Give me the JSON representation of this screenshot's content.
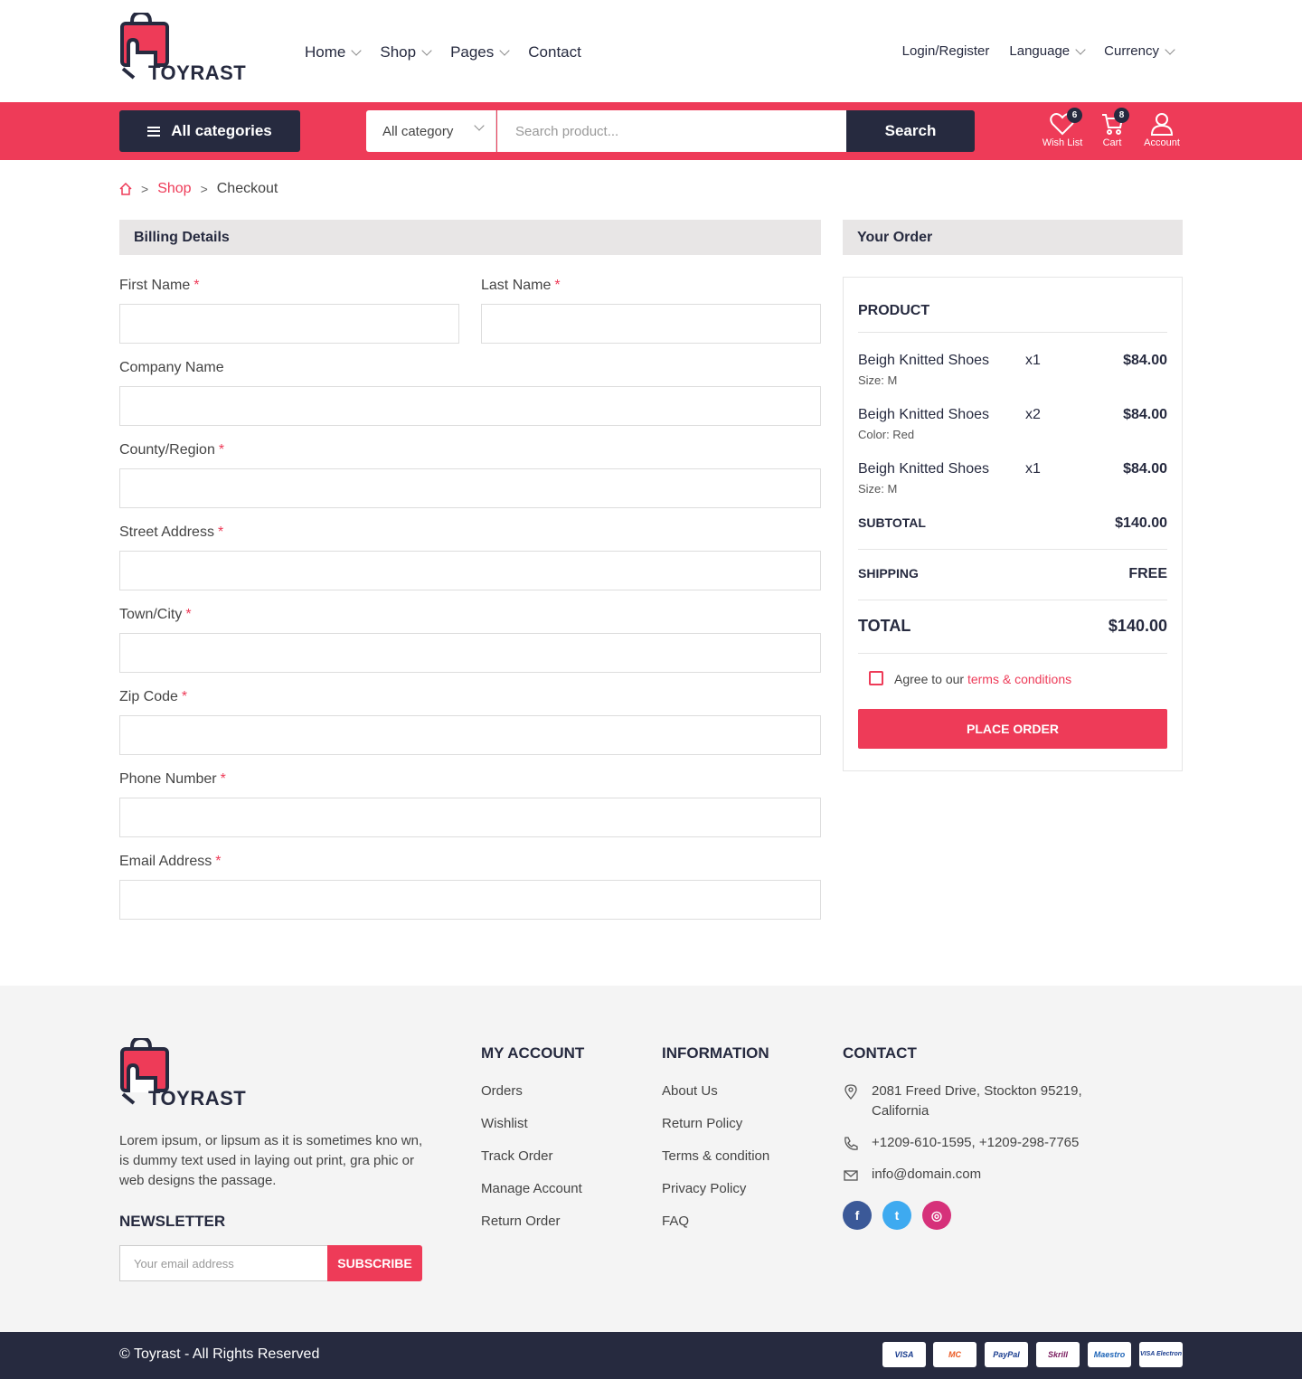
{
  "brand": {
    "name": "TOYRAST",
    "accent": "#ee3b58",
    "dark": "#262a3f"
  },
  "nav": {
    "items": [
      "Home",
      "Shop",
      "Pages",
      "Contact"
    ]
  },
  "topright": {
    "login": "Login/Register",
    "language": "Language",
    "currency": "Currency"
  },
  "toolbar": {
    "all_categories": "All categories",
    "category_select": "All category",
    "search_placeholder": "Search product...",
    "search_button": "Search",
    "wishlist_label": "Wish List",
    "wishlist_count": "6",
    "cart_label": "Cart",
    "cart_count": "8",
    "account_label": "Account"
  },
  "breadcrumb": {
    "shop": "Shop",
    "current": "Checkout"
  },
  "billing": {
    "title": "Billing Details",
    "fields": {
      "first_name": "First Name",
      "last_name": "Last Name",
      "company": "Company Name",
      "county": "County/Region",
      "street": "Street Address",
      "town": "Town/City",
      "zip": "Zip Code",
      "phone": "Phone Number",
      "email": "Email Address"
    },
    "required_mark": "*"
  },
  "order": {
    "title": "Your Order",
    "product_header": "PRODUCT",
    "items": [
      {
        "name": "Beigh Knitted Shoes",
        "qty": "x1",
        "price": "$84.00",
        "detail": "Size: M"
      },
      {
        "name": "Beigh Knitted Shoes",
        "qty": "x2",
        "price": "$84.00",
        "detail": "Color: Red"
      },
      {
        "name": "Beigh Knitted Shoes",
        "qty": "x1",
        "price": "$84.00",
        "detail": "Size: M"
      }
    ],
    "subtotal_label": "SUBTOTAL",
    "subtotal": "$140.00",
    "shipping_label": "SHIPPING",
    "shipping": "FREE",
    "total_label": "TOTAL",
    "total": "$140.00",
    "agree_text": "Agree to our",
    "agree_link": "terms & conditions",
    "place_order": "PLACE ORDER"
  },
  "footer": {
    "about": "Lorem ipsum, or lipsum as it is sometimes kno wn, is dummy text used in laying out print, gra phic or web designs the passage.",
    "newsletter_title": "NEWSLETTER",
    "newsletter_placeholder": "Your email address",
    "subscribe": "SUBSCRIBE",
    "account_title": "MY ACCOUNT",
    "account_links": [
      "Orders",
      "Wishlist",
      "Track Order",
      "Manage Account",
      "Return Order"
    ],
    "info_title": "INFORMATION",
    "info_links": [
      "About Us",
      "Return Policy",
      "Terms & condition",
      "Privacy Policy",
      "FAQ"
    ],
    "contact_title": "CONTACT",
    "address": "2081 Freed Drive, Stockton 95219, California",
    "phone": "+1209-610-1595, +1209-298-7765",
    "email": "info@domain.com",
    "social": [
      {
        "name": "facebook",
        "color": "#3b5998",
        "glyph": "f"
      },
      {
        "name": "twitter",
        "color": "#3eaaf0",
        "glyph": "t"
      },
      {
        "name": "instagram",
        "color": "#d6317a",
        "glyph": "◎"
      }
    ]
  },
  "bottom": {
    "copyright": "© Toyrast - All Rights Reserved",
    "payments": [
      "VISA",
      "MC",
      "PayPal",
      "Skrill",
      "Maestro",
      "VISA Electron"
    ]
  }
}
